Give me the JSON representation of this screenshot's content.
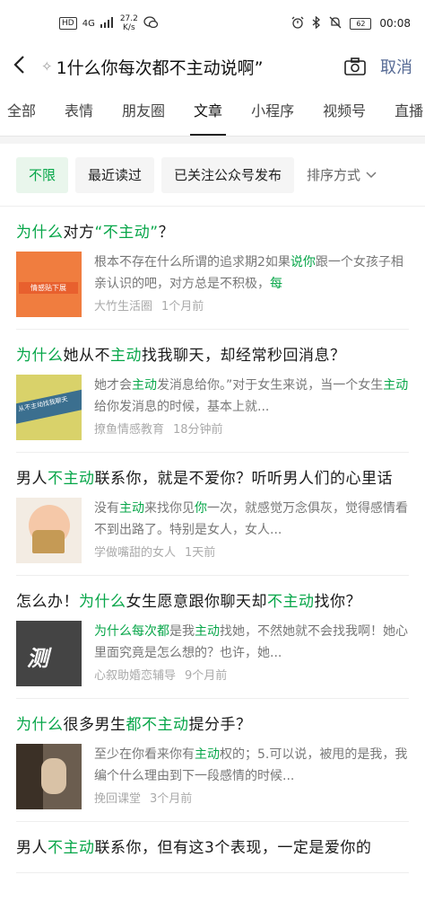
{
  "status": {
    "left_badge": "HD",
    "network": "4G",
    "speed_value": "27.2",
    "speed_unit": "K/s",
    "battery": "62",
    "time": "00:08"
  },
  "search": {
    "query": "1什么你每次都不主动说啊”",
    "cancel_label": "取消"
  },
  "tabs": [
    "全部",
    "表情",
    "朋友圈",
    "文章",
    "小程序",
    "视频号",
    "直播"
  ],
  "active_tab": "文章",
  "filters": {
    "chips": [
      "不限",
      "最近读过",
      "已关注公众号发布"
    ],
    "sort_label": "排序方式"
  },
  "results": [
    {
      "title_parts": [
        {
          "t": "为什么",
          "hl": true
        },
        {
          "t": "对方",
          "hl": false
        },
        {
          "t": "“不主动”",
          "hl": true
        },
        {
          "t": "？",
          "hl": false
        }
      ],
      "snippet_parts": [
        {
          "t": "根本不存在什么所谓的追求期2如果",
          "hl": false
        },
        {
          "t": "说你",
          "hl": true
        },
        {
          "t": "跟一个女孩子相亲认识的吧，对方总是不积极，",
          "hl": false
        },
        {
          "t": "每",
          "hl": true
        }
      ],
      "source": "大竹生活圈",
      "time": "1个月前",
      "thumb_label": "情感贴下展"
    },
    {
      "title_parts": [
        {
          "t": "为什么",
          "hl": true
        },
        {
          "t": "她从不",
          "hl": false
        },
        {
          "t": "主动",
          "hl": true
        },
        {
          "t": "找我聊天，却经常秒回消息？",
          "hl": false
        }
      ],
      "snippet_parts": [
        {
          "t": "她才会",
          "hl": false
        },
        {
          "t": "主动",
          "hl": true
        },
        {
          "t": "发消息给你。”对于女生来说，当一个女生",
          "hl": false
        },
        {
          "t": "主动",
          "hl": true
        },
        {
          "t": "给你发消息的时候，基本上就...",
          "hl": false
        }
      ],
      "source": "撩鱼情感教育",
      "time": "18分钟前",
      "thumb_label": "从不主动找我聊天"
    },
    {
      "title_parts": [
        {
          "t": "男人",
          "hl": false
        },
        {
          "t": "不主动",
          "hl": true
        },
        {
          "t": "联系你，就是不爱你？听听男人们的心里话",
          "hl": false
        }
      ],
      "snippet_parts": [
        {
          "t": "没有",
          "hl": false
        },
        {
          "t": "主动",
          "hl": true
        },
        {
          "t": "来找你见",
          "hl": false
        },
        {
          "t": "你",
          "hl": true
        },
        {
          "t": "一次，就感觉万念俱灰，觉得感情看不到出路了。特别是女人，女人...",
          "hl": false
        }
      ],
      "source": "学做嘴甜的女人",
      "time": "1天前",
      "thumb_label": ""
    },
    {
      "title_parts": [
        {
          "t": "怎么办！",
          "hl": false
        },
        {
          "t": "为什么",
          "hl": true
        },
        {
          "t": "女生愿意跟你聊天却",
          "hl": false
        },
        {
          "t": "不主动",
          "hl": true
        },
        {
          "t": "找你？",
          "hl": false
        }
      ],
      "snippet_parts": [
        {
          "t": "为什么每次都",
          "hl": true
        },
        {
          "t": "是我",
          "hl": false
        },
        {
          "t": "主动",
          "hl": true
        },
        {
          "t": "找她，不然她就不会找我啊！她心里面究竟是怎么想的？也许，她...",
          "hl": false
        }
      ],
      "source": "心叙助婚恋辅导",
      "time": "9个月前",
      "thumb_label": "测"
    },
    {
      "title_parts": [
        {
          "t": "为什么",
          "hl": true
        },
        {
          "t": "很多男生",
          "hl": false
        },
        {
          "t": "都不主动",
          "hl": true
        },
        {
          "t": "提分手？",
          "hl": false
        }
      ],
      "snippet_parts": [
        {
          "t": "至少在你看来你有",
          "hl": false
        },
        {
          "t": "主动",
          "hl": true
        },
        {
          "t": "权的；5.可以说，被甩的是我，我编个什么理由到下一段感情的时候...",
          "hl": false
        }
      ],
      "source": "挽回课堂",
      "time": "3个月前",
      "thumb_label": ""
    },
    {
      "title_parts": [
        {
          "t": "男人",
          "hl": false
        },
        {
          "t": "不主动",
          "hl": true
        },
        {
          "t": "联系你，但有这3个表现，一定是爱你的",
          "hl": false
        }
      ],
      "snippet_parts": [],
      "source": "",
      "time": "",
      "thumb_label": ""
    }
  ]
}
